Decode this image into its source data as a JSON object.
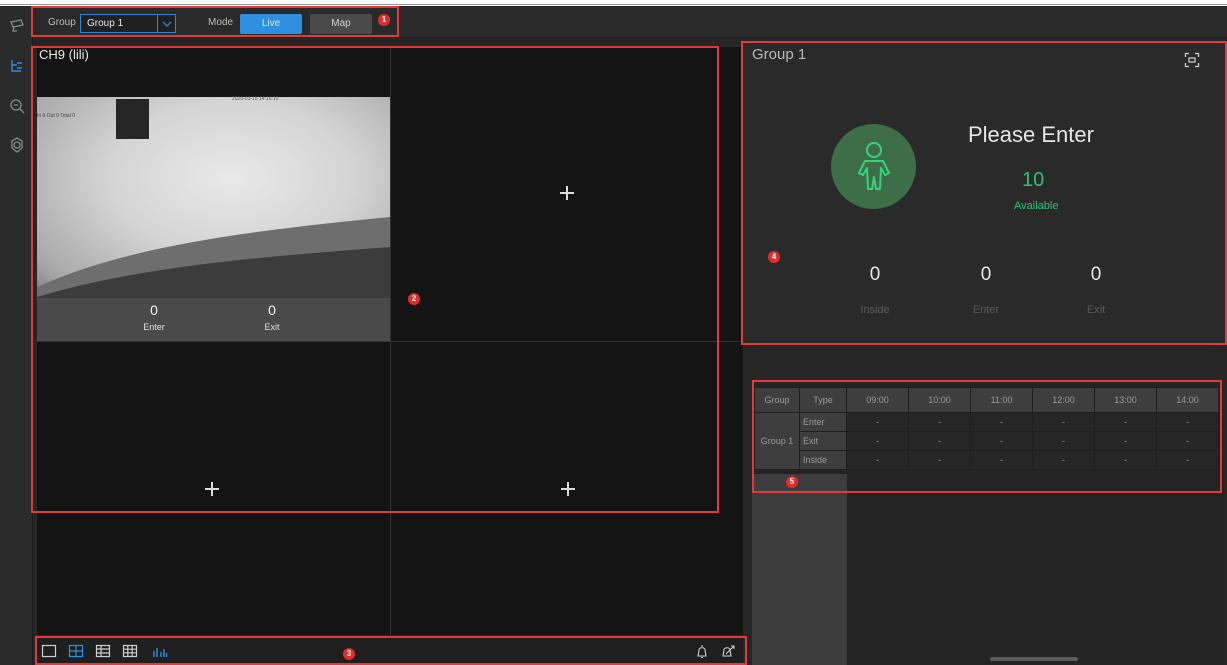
{
  "toolbar": {
    "group_label": "Group",
    "group_value": "Group 1",
    "mode_label": "Mode",
    "mode_live": "Live",
    "mode_map": "Map"
  },
  "rail": {
    "icons": [
      "camera-icon",
      "people-counting-icon",
      "search-icon",
      "settings-icon"
    ]
  },
  "video": {
    "channel_title": "CH9 (lili)",
    "osd_timestamp": "2026-03-15 14:16:10",
    "osd_counts": "In 0 Out 0 Total 0",
    "enter_count": "0",
    "enter_label": "Enter",
    "exit_count": "0",
    "exit_label": "Exit"
  },
  "occupancy": {
    "group_title": "Group 1",
    "status": "Please Enter",
    "available_count": "10",
    "available_label": "Available",
    "inside_count": "0",
    "inside_label": "Inside",
    "enter_count": "0",
    "enter_label": "Enter",
    "exit_count": "0",
    "exit_label": "Exit",
    "accent_color": "#2fc07a"
  },
  "table": {
    "headers": [
      "Group",
      "Type",
      "09:00",
      "10:00",
      "11:00",
      "12:00",
      "13:00",
      "14:00"
    ],
    "group_name": "Group 1",
    "rows": [
      {
        "type": "Enter",
        "values": [
          "-",
          "-",
          "-",
          "-",
          "-",
          "-"
        ]
      },
      {
        "type": "Exit",
        "values": [
          "-",
          "-",
          "-",
          "-",
          "-",
          "-"
        ]
      },
      {
        "type": "Inside",
        "values": [
          "-",
          "-",
          "-",
          "-",
          "-",
          "-"
        ]
      }
    ]
  },
  "markers": [
    "1",
    "2",
    "3",
    "4",
    "5"
  ],
  "colors": {
    "annotation_red": "#e23a3a",
    "live_blue": "#2f8fe0",
    "person_circle": "#3d6e48"
  }
}
